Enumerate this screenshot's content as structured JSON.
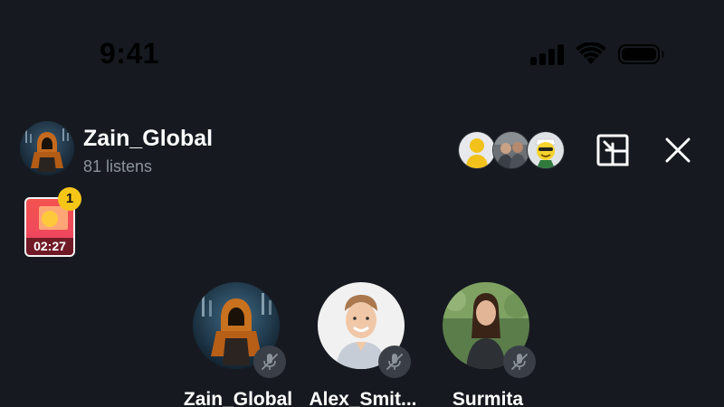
{
  "status_bar": {
    "time": "9:41",
    "icons": [
      "cellular-signal-icon",
      "wifi-icon",
      "battery-icon"
    ]
  },
  "room": {
    "host_name": "Zain_Global",
    "listens": "81 listens",
    "listener_avatars": [
      "listener-avatar-yellow",
      "listener-avatar-photo",
      "listener-avatar-emoji"
    ]
  },
  "controls": {
    "minimize_icon": "minimize-icon",
    "close_icon": "close-icon"
  },
  "gift": {
    "timer": "02:27",
    "badge_count": "1"
  },
  "speakers": [
    {
      "name": "Zain_Global",
      "muted": true
    },
    {
      "name": "Alex_Smit...",
      "muted": true
    },
    {
      "name": "Surmita",
      "muted": true
    }
  ],
  "colors": {
    "background": "#161a20",
    "secondary_text": "#8d939c",
    "badge": "#f5c518",
    "gift_red": "#f04a5b",
    "mic_bg": "#3a3f47"
  }
}
